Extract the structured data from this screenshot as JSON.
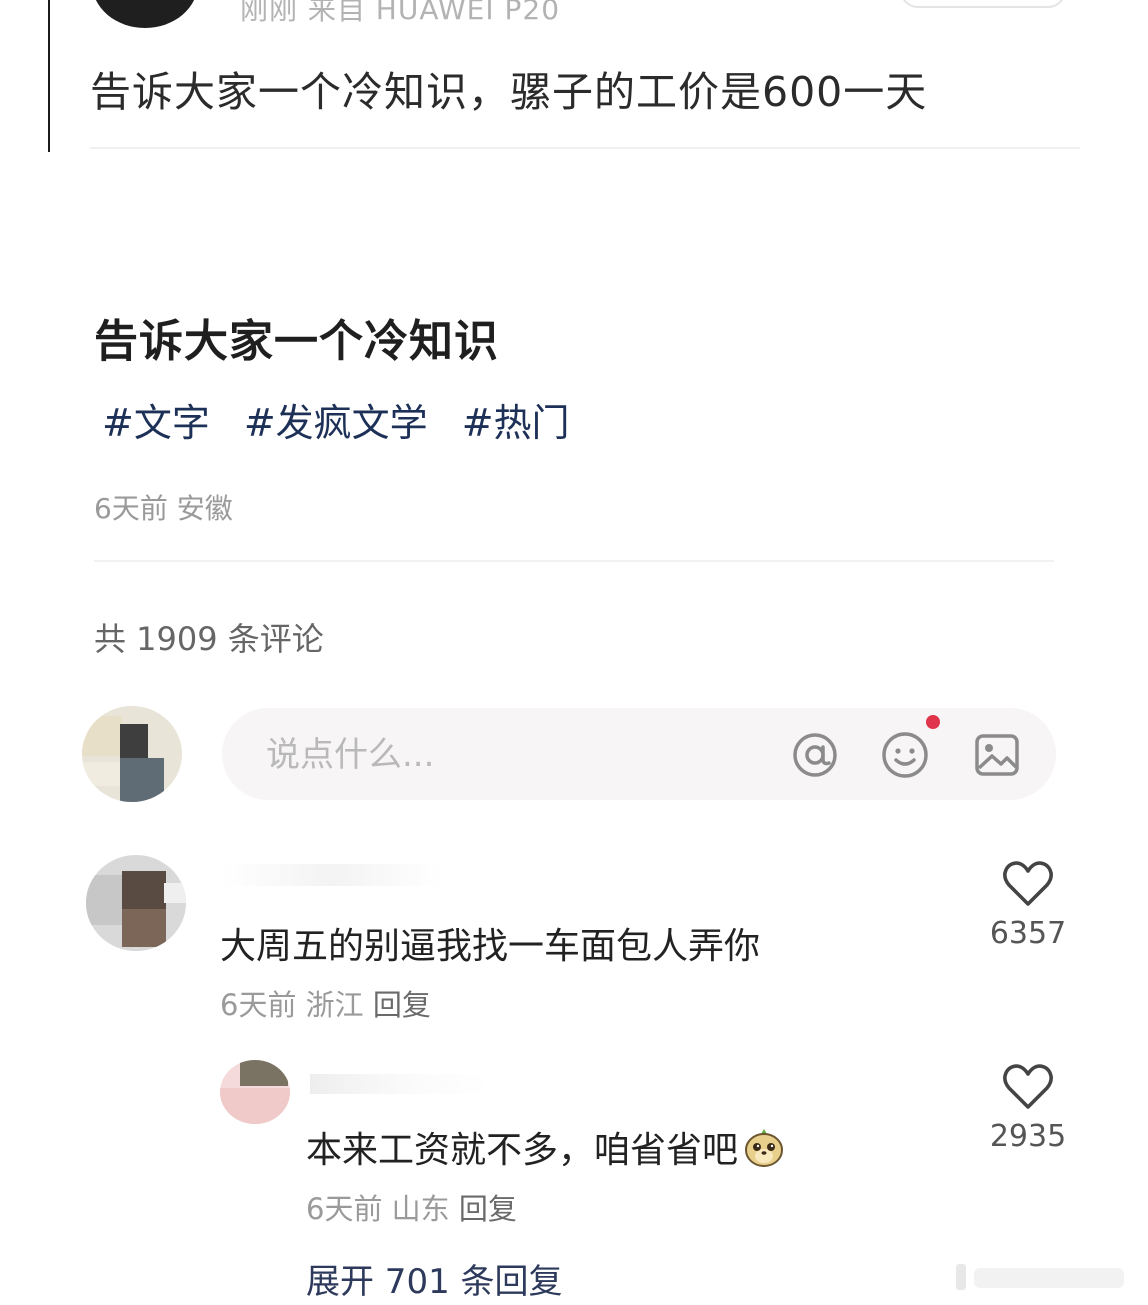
{
  "top_post": {
    "meta": "刚刚 来自 HUAWEI P20",
    "text": "告诉大家一个冷知识，骡子的工价是600一天"
  },
  "post": {
    "title": "告诉大家一个冷知识",
    "tags": [
      "#文字",
      "#发疯文学",
      "#热门"
    ],
    "meta": "6天前 安徽"
  },
  "comments_header": "共 1909 条评论",
  "comment_input": {
    "placeholder": "说点什么...",
    "icons": [
      "at-icon",
      "emoji-icon",
      "image-icon"
    ],
    "notification_color": "#e0344a"
  },
  "comments": [
    {
      "text": "大周五的别逼我找一车面包人弄你",
      "time": "6天前",
      "location": "浙江",
      "reply_label": "回复",
      "likes": "6357"
    },
    {
      "text": "本来工资就不多，咱省省吧",
      "time": "6天前",
      "location": "山东",
      "reply_label": "回复",
      "likes": "2935"
    }
  ],
  "expand_replies": "展开 701 条回复",
  "colors": {
    "tag": "#1d3057",
    "link": "#2d3a5c",
    "meta": "#9a9a9a"
  }
}
